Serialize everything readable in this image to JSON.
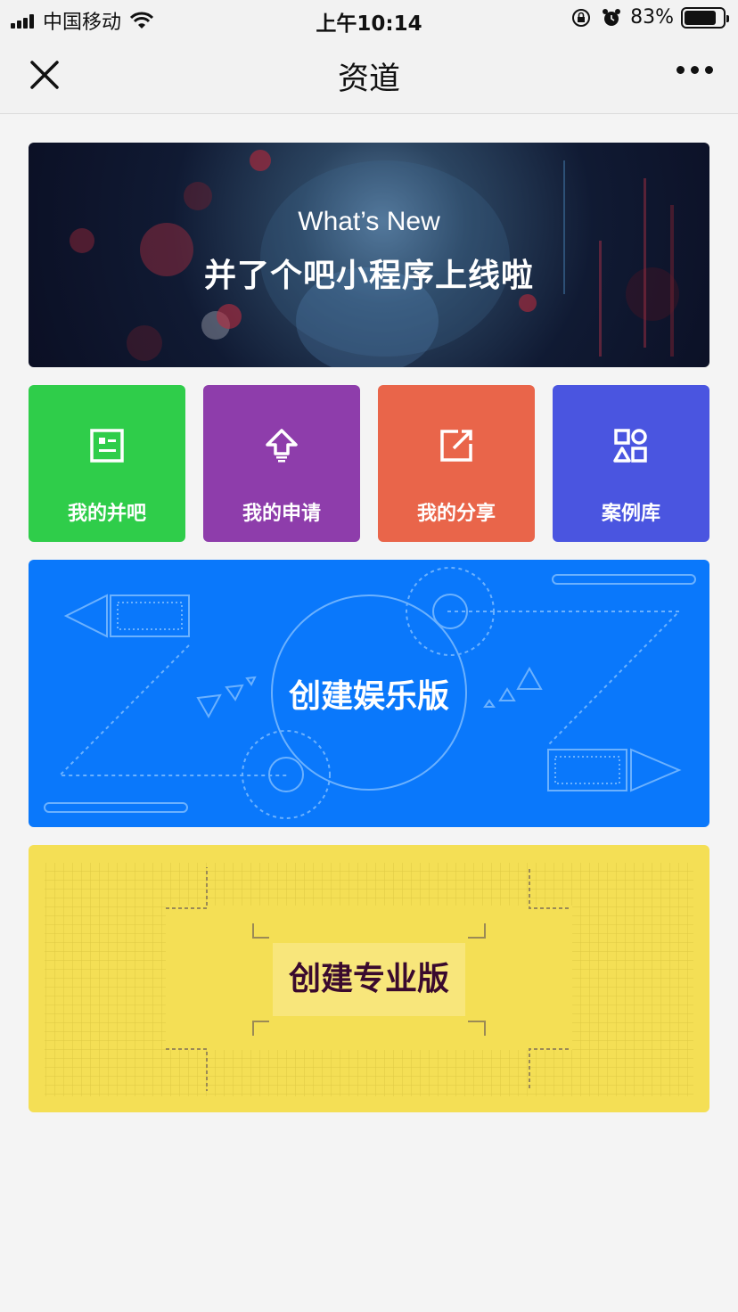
{
  "status_bar": {
    "carrier": "中国移动",
    "time": "上午10:14",
    "battery_percent": "83%",
    "battery_level": 0.83
  },
  "nav": {
    "title": "资道"
  },
  "banner": {
    "title_en": "What’s New",
    "title_cn": "并了个吧小程序上线啦"
  },
  "tiles": [
    {
      "label": "我的并吧",
      "color": "#2fcd4a",
      "icon": "id-card-icon"
    },
    {
      "label": "我的申请",
      "color": "#8e3dab",
      "icon": "upload-arrow-icon"
    },
    {
      "label": "我的分享",
      "color": "#e9654a",
      "icon": "share-out-icon"
    },
    {
      "label": "案例库",
      "color": "#4a55e0",
      "icon": "shapes-icon"
    }
  ],
  "cards": {
    "entertainment": {
      "label": "创建娱乐版",
      "color": "#0a78fb"
    },
    "professional": {
      "label": "创建专业版",
      "color": "#f4df55"
    }
  }
}
